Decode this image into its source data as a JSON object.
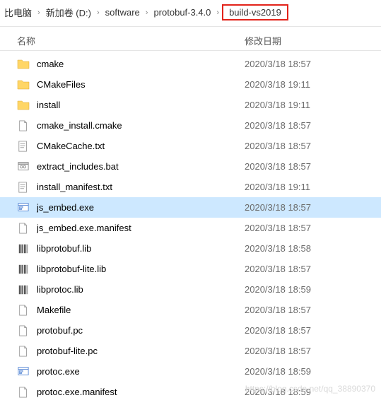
{
  "breadcrumb": {
    "items": [
      "比电脑",
      "新加卷 (D:)",
      "software",
      "protobuf-3.4.0",
      "build-vs2019"
    ],
    "highlightIndex": 4
  },
  "columns": {
    "name": "名称",
    "date": "修改日期"
  },
  "files": [
    {
      "icon": "folder",
      "name": "cmake",
      "date": "2020/3/18 18:57",
      "selected": false
    },
    {
      "icon": "folder",
      "name": "CMakeFiles",
      "date": "2020/3/18 19:11",
      "selected": false
    },
    {
      "icon": "folder",
      "name": "install",
      "date": "2020/3/18 19:11",
      "selected": false
    },
    {
      "icon": "file",
      "name": "cmake_install.cmake",
      "date": "2020/3/18 18:57",
      "selected": false
    },
    {
      "icon": "txt",
      "name": "CMakeCache.txt",
      "date": "2020/3/18 18:57",
      "selected": false
    },
    {
      "icon": "bat",
      "name": "extract_includes.bat",
      "date": "2020/3/18 18:57",
      "selected": false
    },
    {
      "icon": "txt",
      "name": "install_manifest.txt",
      "date": "2020/3/18 19:11",
      "selected": false
    },
    {
      "icon": "exe",
      "name": "js_embed.exe",
      "date": "2020/3/18 18:57",
      "selected": true
    },
    {
      "icon": "file",
      "name": "js_embed.exe.manifest",
      "date": "2020/3/18 18:57",
      "selected": false
    },
    {
      "icon": "lib",
      "name": "libprotobuf.lib",
      "date": "2020/3/18 18:58",
      "selected": false
    },
    {
      "icon": "lib",
      "name": "libprotobuf-lite.lib",
      "date": "2020/3/18 18:57",
      "selected": false
    },
    {
      "icon": "lib",
      "name": "libprotoc.lib",
      "date": "2020/3/18 18:59",
      "selected": false
    },
    {
      "icon": "file",
      "name": "Makefile",
      "date": "2020/3/18 18:57",
      "selected": false
    },
    {
      "icon": "file",
      "name": "protobuf.pc",
      "date": "2020/3/18 18:57",
      "selected": false
    },
    {
      "icon": "file",
      "name": "protobuf-lite.pc",
      "date": "2020/3/18 18:57",
      "selected": false
    },
    {
      "icon": "exe",
      "name": "protoc.exe",
      "date": "2020/3/18 18:59",
      "selected": false
    },
    {
      "icon": "file",
      "name": "protoc.exe.manifest",
      "date": "2020/3/18 18:59",
      "selected": false
    }
  ],
  "watermark": "https://blog.csdn.net/qq_38890370"
}
